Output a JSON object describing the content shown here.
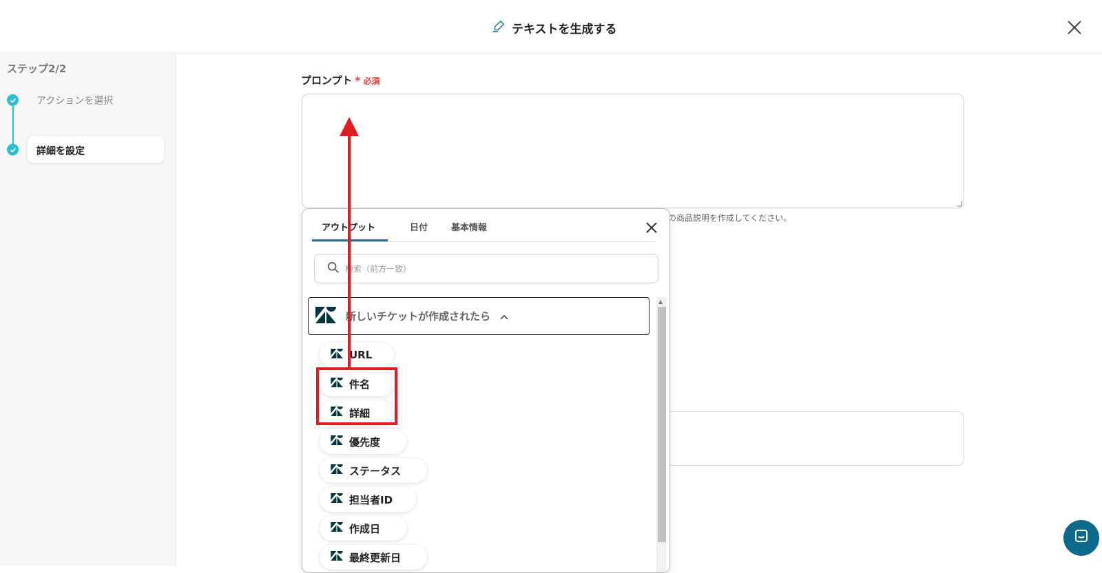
{
  "header": {
    "title": "テキストを生成する"
  },
  "sidebar": {
    "step_label": "ステップ2/2",
    "steps": [
      {
        "label": "アクションを選択"
      },
      {
        "label": "詳細を設定"
      }
    ]
  },
  "main": {
    "prompt_label": "プロンプト",
    "required_star": "*",
    "required_text": "必須",
    "helper_text": "の商品説明を作成してください。"
  },
  "popup": {
    "tabs": [
      {
        "label": "アウトプット"
      },
      {
        "label": "日付"
      },
      {
        "label": "基本情報"
      }
    ],
    "search_placeholder": "検索（前方一致）",
    "group_title": "新しいチケットが作成されたら",
    "items": [
      {
        "label": "URL"
      },
      {
        "label": "件名"
      },
      {
        "label": "詳細"
      },
      {
        "label": "優先度"
      },
      {
        "label": "ステータス"
      },
      {
        "label": "担当者ID"
      },
      {
        "label": "作成日"
      },
      {
        "label": "最終更新日"
      }
    ]
  },
  "colors": {
    "accent": "#2bbfcf",
    "annotation_red": "#e01b22",
    "tab_underline": "#2b6f8a",
    "chat": "#0b6a8a"
  }
}
